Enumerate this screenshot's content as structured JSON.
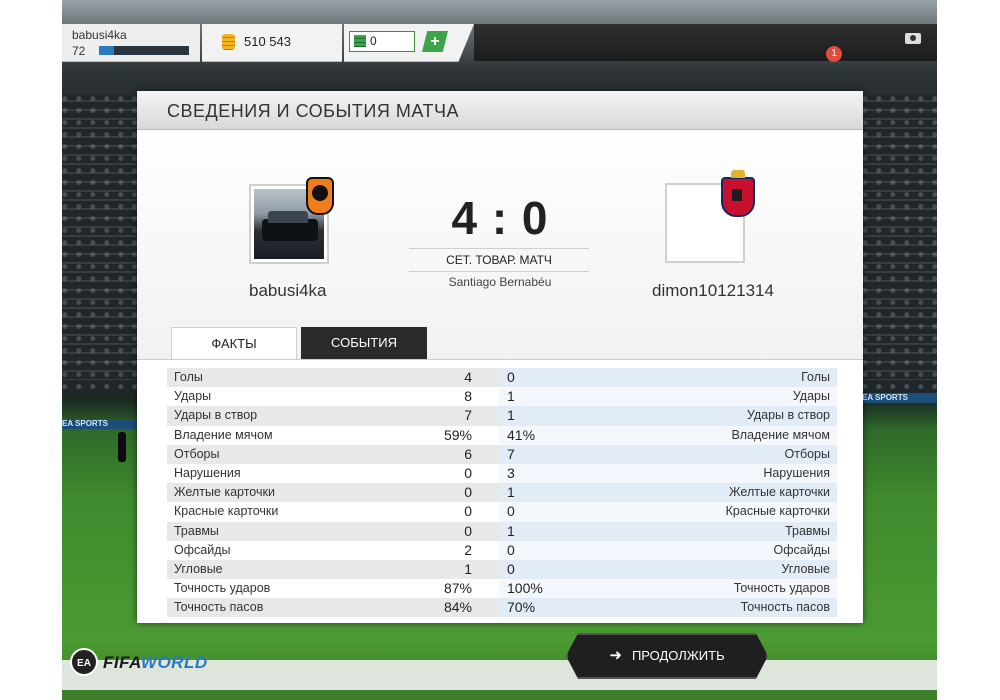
{
  "topbar": {
    "username": "babusi4ka",
    "level": "72",
    "xp_fraction": 0.17,
    "coins": "510 543",
    "points": "0",
    "add_label": "+",
    "notification_count": "1"
  },
  "panel": {
    "title": "СВЕДЕНИЯ И СОБЫТИЯ МАТЧА"
  },
  "match": {
    "home_name": "babusi4ka",
    "away_name": "dimon10121314",
    "score": "4 : 0",
    "type": "СЕТ. ТОВАР. МАТЧ",
    "stadium": "Santiago Bernabéu"
  },
  "tabs": {
    "facts": "ФАКТЫ",
    "events": "СОБЫТИЯ"
  },
  "stats": [
    {
      "label": "Голы",
      "home": "4",
      "away": "0"
    },
    {
      "label": "Удары",
      "home": "8",
      "away": "1"
    },
    {
      "label": "Удары в створ",
      "home": "7",
      "away": "1"
    },
    {
      "label": "Владение мячом",
      "home": "59%",
      "away": "41%"
    },
    {
      "label": "Отборы",
      "home": "6",
      "away": "7"
    },
    {
      "label": "Нарушения",
      "home": "0",
      "away": "3"
    },
    {
      "label": "Желтые карточки",
      "home": "0",
      "away": "1"
    },
    {
      "label": "Красные карточки",
      "home": "0",
      "away": "0"
    },
    {
      "label": "Травмы",
      "home": "0",
      "away": "1"
    },
    {
      "label": "Офсайды",
      "home": "2",
      "away": "0"
    },
    {
      "label": "Угловые",
      "home": "1",
      "away": "0"
    },
    {
      "label": "Точность ударов",
      "home": "87%",
      "away": "100%"
    },
    {
      "label": "Точность пасов",
      "home": "84%",
      "away": "70%"
    }
  ],
  "footer": {
    "logo_ea": "EA",
    "logo_fifa": "FIFA",
    "logo_world": "WORLD",
    "continue_label": "ПРОДОЛЖИТЬ"
  },
  "colors": {
    "accent_green": "#3da447",
    "panel_bg": "#ffffff",
    "button_dark": "#1f1f1f",
    "notification": "#e24c3b"
  }
}
